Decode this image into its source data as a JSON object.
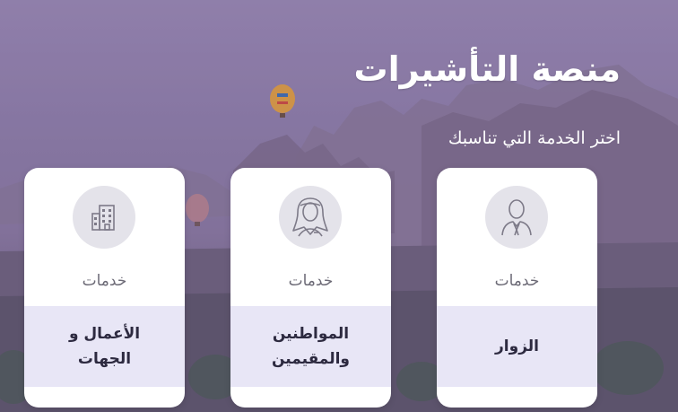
{
  "page": {
    "title": "منصة التأشيرات",
    "subtitle": "اختر الخدمة التي تناسبك"
  },
  "cards": [
    {
      "category": "خدمات",
      "label": "الأعمال و الجهات",
      "icon": "building-icon"
    },
    {
      "category": "خدمات",
      "label": "المواطنين والمقيمين",
      "icon": "citizen-icon"
    },
    {
      "category": "خدمات",
      "label": "الزوار",
      "icon": "visitor-icon"
    }
  ],
  "colors": {
    "card_band": "#e8e6f6",
    "label_text": "#2d2a40",
    "icon_circle": "#e4e3ea"
  }
}
